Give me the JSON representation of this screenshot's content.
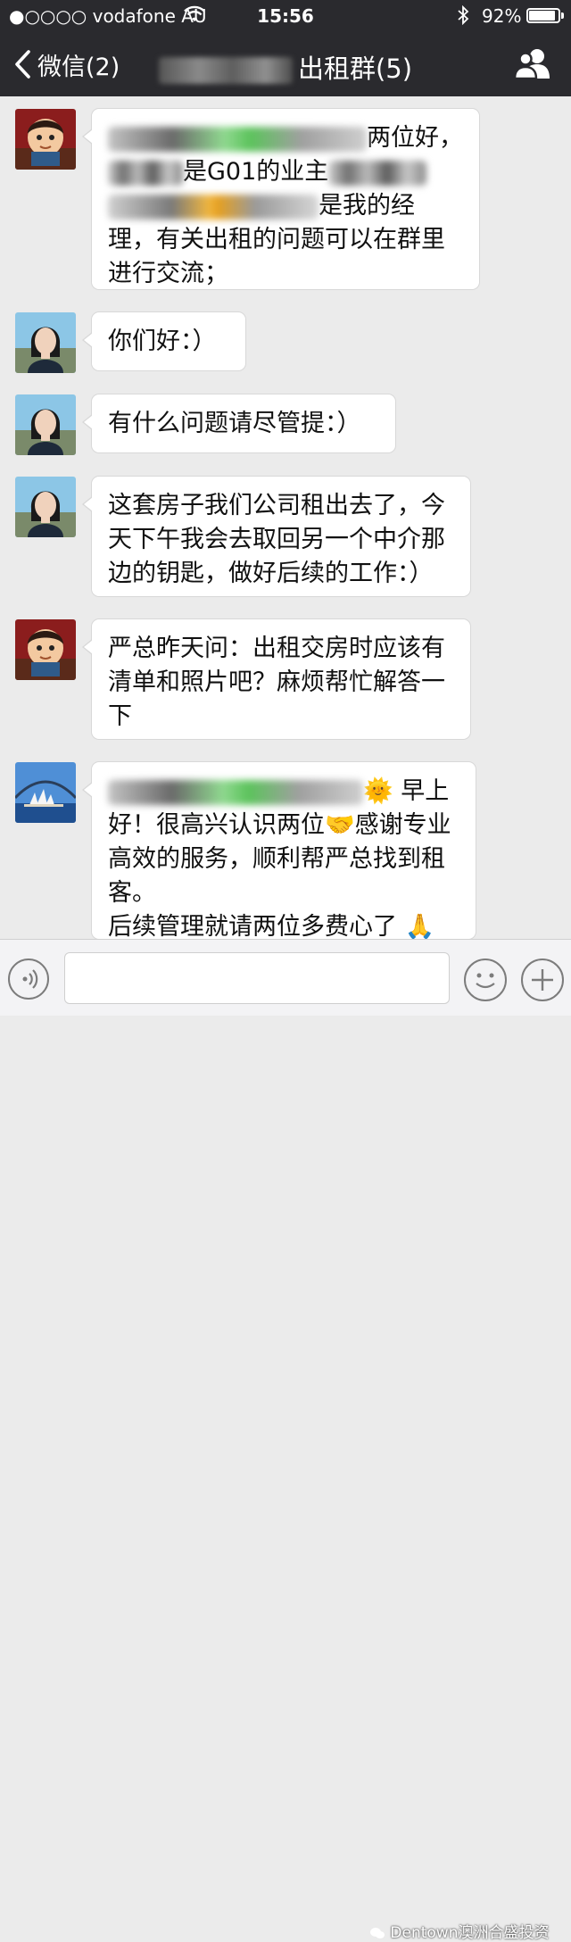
{
  "status_bar": {
    "carrier": "●○○○○ vodafone AU",
    "time": "15:56",
    "battery_percent": "92%",
    "battery_level": 0.92
  },
  "nav": {
    "back_label": "微信(2)",
    "title": "出租群(5)"
  },
  "messages": [
    {
      "sender": "cartoon-avatar",
      "segments": [
        {
          "blur": 290,
          "tone": "green"
        },
        {
          "text": "两位好，"
        },
        {
          "br": true
        },
        {
          "blur": 84
        },
        {
          "text": "是G01的业主"
        },
        {
          "blur": 110
        },
        {
          "br": true
        },
        {
          "blur": 236,
          "tone": "yellow"
        },
        {
          "text": "是我的经"
        },
        {
          "br": true
        },
        {
          "text": "理，有关出租的问题可以在群里"
        },
        {
          "br": true
        },
        {
          "text": "进行交流；"
        }
      ]
    },
    {
      "sender": "woman-avatar",
      "segments": [
        {
          "text": "你们好：）"
        }
      ]
    },
    {
      "sender": "woman-avatar",
      "segments": [
        {
          "text": "有什么问题请尽管提：）"
        }
      ]
    },
    {
      "sender": "woman-avatar",
      "segments": [
        {
          "text": "这套房子我们公司租出去了，今"
        },
        {
          "br": true
        },
        {
          "text": "天下午我会去取回另一个中介那"
        },
        {
          "br": true
        },
        {
          "text": "边的钥匙，做好后续的工作：）"
        }
      ]
    },
    {
      "sender": "cartoon-avatar",
      "segments": [
        {
          "text": "严总昨天问：出租交房时应该有"
        },
        {
          "br": true
        },
        {
          "text": "清单和照片吧？麻烦帮忙解答一"
        },
        {
          "br": true
        },
        {
          "text": "下"
        }
      ]
    },
    {
      "sender": "sydney-avatar",
      "segments": [
        {
          "blur": 286,
          "tone": "green"
        },
        {
          "text": "🌞 早上"
        },
        {
          "br": true
        },
        {
          "text": "好！很高兴认识两位🤝感谢专业"
        },
        {
          "br": true
        },
        {
          "text": "高效的服务，顺利帮严总找到租"
        },
        {
          "br": true
        },
        {
          "text": "客。"
        },
        {
          "br": true
        },
        {
          "text": "后续管理就请两位多费心了 🙏"
        }
      ]
    }
  ],
  "watermark": "Dentown澳洲合盛投资"
}
